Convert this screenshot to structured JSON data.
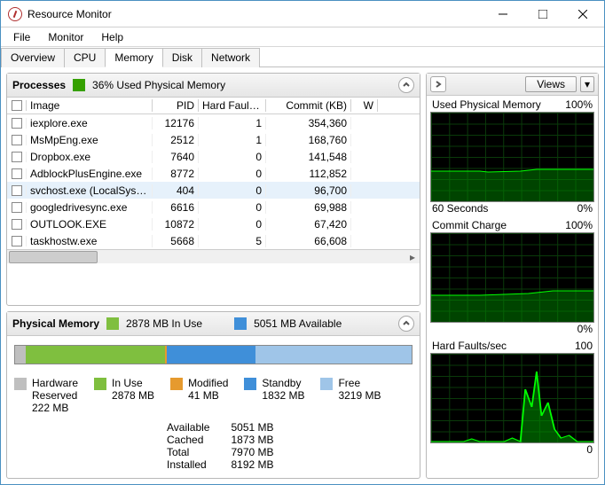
{
  "window": {
    "title": "Resource Monitor"
  },
  "menu": {
    "file": "File",
    "monitor": "Monitor",
    "help": "Help"
  },
  "tabs": {
    "overview": "Overview",
    "cpu": "CPU",
    "memory": "Memory",
    "disk": "Disk",
    "network": "Network"
  },
  "processes": {
    "title": "Processes",
    "usage_text": "36% Used Physical Memory",
    "columns": {
      "image": "Image",
      "pid": "PID",
      "hard_faults": "Hard Faults...",
      "commit": "Commit (KB)",
      "w": "W"
    },
    "rows": [
      {
        "image": "iexplore.exe",
        "pid": "12176",
        "hf": "1",
        "commit": "354,360",
        "selected": false
      },
      {
        "image": "MsMpEng.exe",
        "pid": "2512",
        "hf": "1",
        "commit": "168,760",
        "selected": false
      },
      {
        "image": "Dropbox.exe",
        "pid": "7640",
        "hf": "0",
        "commit": "141,548",
        "selected": false
      },
      {
        "image": "AdblockPlusEngine.exe",
        "pid": "8772",
        "hf": "0",
        "commit": "112,852",
        "selected": false
      },
      {
        "image": "svchost.exe (LocalSystemNet...",
        "pid": "404",
        "hf": "0",
        "commit": "96,700",
        "selected": true
      },
      {
        "image": "googledrivesync.exe",
        "pid": "6616",
        "hf": "0",
        "commit": "69,988",
        "selected": false
      },
      {
        "image": "OUTLOOK.EXE",
        "pid": "10872",
        "hf": "0",
        "commit": "67,420",
        "selected": false
      },
      {
        "image": "taskhostw.exe",
        "pid": "5668",
        "hf": "5",
        "commit": "66,608",
        "selected": false
      }
    ]
  },
  "physical": {
    "title": "Physical Memory",
    "in_use_hdr": "2878 MB In Use",
    "available_hdr": "5051 MB Available",
    "bar": {
      "hw_reserved_pct": 2.7,
      "in_use_pct": 35.1,
      "modified_pct": 0.5,
      "standby_pct": 22.4,
      "free_pct": 39.3
    },
    "legend": {
      "hw": {
        "label": "Hardware\nReserved",
        "value": "222 MB",
        "color": "#bfbfbf"
      },
      "inuse": {
        "label": "In Use",
        "value": "2878 MB",
        "color": "#7fbf3f"
      },
      "modified": {
        "label": "Modified",
        "value": "41 MB",
        "color": "#e69a2e"
      },
      "standby": {
        "label": "Standby",
        "value": "1832 MB",
        "color": "#3f8fd9"
      },
      "free": {
        "label": "Free",
        "value": "3219 MB",
        "color": "#9fc5e8"
      }
    },
    "stats": {
      "available": {
        "label": "Available",
        "value": "5051 MB"
      },
      "cached": {
        "label": "Cached",
        "value": "1873 MB"
      },
      "total": {
        "label": "Total",
        "value": "7970 MB"
      },
      "installed": {
        "label": "Installed",
        "value": "8192 MB"
      }
    }
  },
  "right": {
    "views": "Views",
    "charts": {
      "used": {
        "title": "Used Physical Memory",
        "max": "100%",
        "xleft": "60 Seconds",
        "xright": "0%"
      },
      "commit": {
        "title": "Commit Charge",
        "max": "100%",
        "xright": "0%"
      },
      "hf": {
        "title": "Hard Faults/sec",
        "max": "100",
        "xright": "0"
      }
    }
  }
}
